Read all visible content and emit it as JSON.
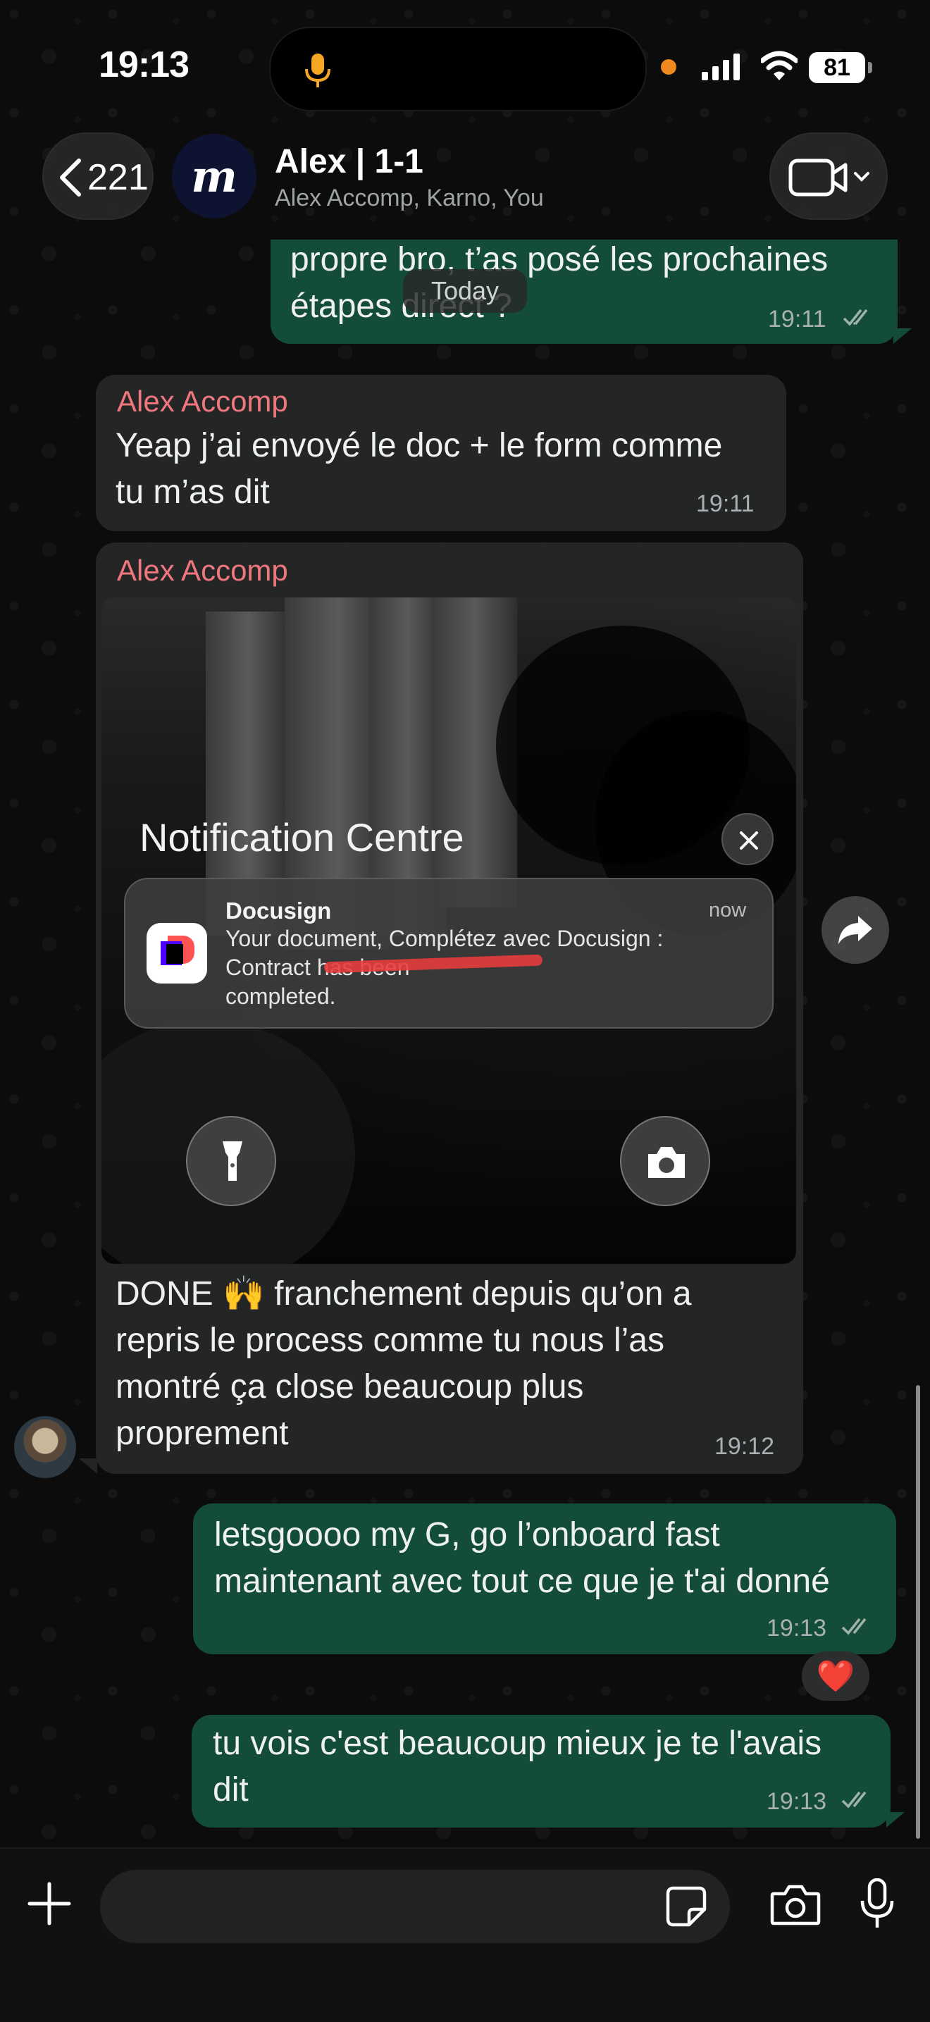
{
  "status_bar": {
    "time": "19:13",
    "battery": "81",
    "recording_dot_color": "#f08a1e",
    "mic_indicator_color": "#f5a623"
  },
  "header": {
    "back_count": "221",
    "avatar_letter": "m",
    "title": "Alex | 1-1",
    "subtitle": "Alex Accomp, Karno, You"
  },
  "date_divider": "Today",
  "messages": [
    {
      "direction": "outgoing",
      "text": "propre bro, t’as posé les prochaines\nétapes direct ?",
      "time": "19:11",
      "status": "read"
    },
    {
      "direction": "incoming",
      "sender": "Alex Accomp",
      "text": "Yeap j’ai envoyé le doc + le form comme\ntu m’as dit",
      "time": "19:11"
    },
    {
      "direction": "incoming",
      "sender": "Alex Accomp",
      "image": {
        "notification_centre_title": "Notification Centre",
        "notification": {
          "app": "Docusign",
          "time": "now",
          "body": "Your document, Complétez avec Docusign :\nContract                                    has been\ncompleted."
        }
      },
      "text": "DONE 🙌 franchement depuis qu’on a\nrepris le process comme tu nous l’as\nmontré ça close beaucoup plus\nproprement",
      "time": "19:12"
    },
    {
      "direction": "outgoing",
      "text": "letsgoooo my G, go l’onboard fast\nmaintenant avec tout ce que je t'ai donné",
      "time": "19:13",
      "status": "read",
      "reaction": "❤️"
    },
    {
      "direction": "outgoing",
      "text": "tu vois c'est beaucoup mieux je te l'avais\ndit",
      "time": "19:13",
      "status": "read"
    }
  ],
  "composer": {
    "value": "",
    "placeholder": ""
  },
  "colors": {
    "outgoing_bubble": "#144d37",
    "incoming_bubble": "#242626",
    "sender_name": "#f0777f",
    "background": "#0c0c0c"
  },
  "icons": {
    "back": "chevron-left-icon",
    "video": "video-call-icon",
    "forward": "forward-icon",
    "plus": "plus-icon",
    "sticker": "sticker-icon",
    "camera": "camera-icon",
    "mic": "microphone-icon"
  }
}
